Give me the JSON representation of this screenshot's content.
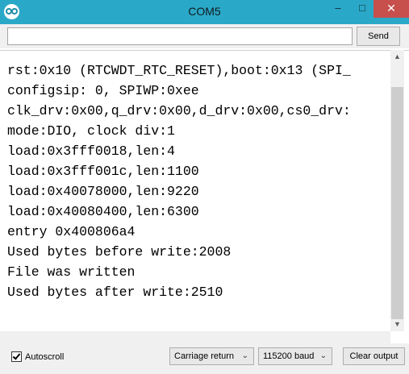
{
  "window": {
    "title": "COM5",
    "minimize_glyph": "–",
    "maximize_glyph": "□",
    "close_glyph": "✕"
  },
  "send": {
    "input_value": "",
    "button_label": "Send"
  },
  "output": {
    "lines": [
      "rst:0x10 (RTCWDT_RTC_RESET),boot:0x13 (SPI_",
      "configsip: 0, SPIWP:0xee",
      "clk_drv:0x00,q_drv:0x00,d_drv:0x00,cs0_drv:",
      "mode:DIO, clock div:1",
      "load:0x3fff0018,len:4",
      "load:0x3fff001c,len:1100",
      "load:0x40078000,len:9220",
      "load:0x40080400,len:6300",
      "entry 0x400806a4",
      "Used bytes before write:2008",
      "File was written",
      "Used bytes after write:2510"
    ]
  },
  "scrollbar": {
    "up_glyph": "▲",
    "down_glyph": "▼"
  },
  "footer": {
    "autoscroll_label": "Autoscroll",
    "autoscroll_checked": true,
    "line_ending": "Carriage return",
    "baud_rate": "115200 baud",
    "dropdown_glyph": "⌄",
    "clear_label": "Clear output"
  },
  "icons": {
    "app": "arduino-logo-icon",
    "checkbox": "checkmark-icon",
    "dropdown": "chevron-down-icon"
  },
  "colors": {
    "titlebar": "#2aa8c7",
    "close_button": "#c7504c"
  }
}
